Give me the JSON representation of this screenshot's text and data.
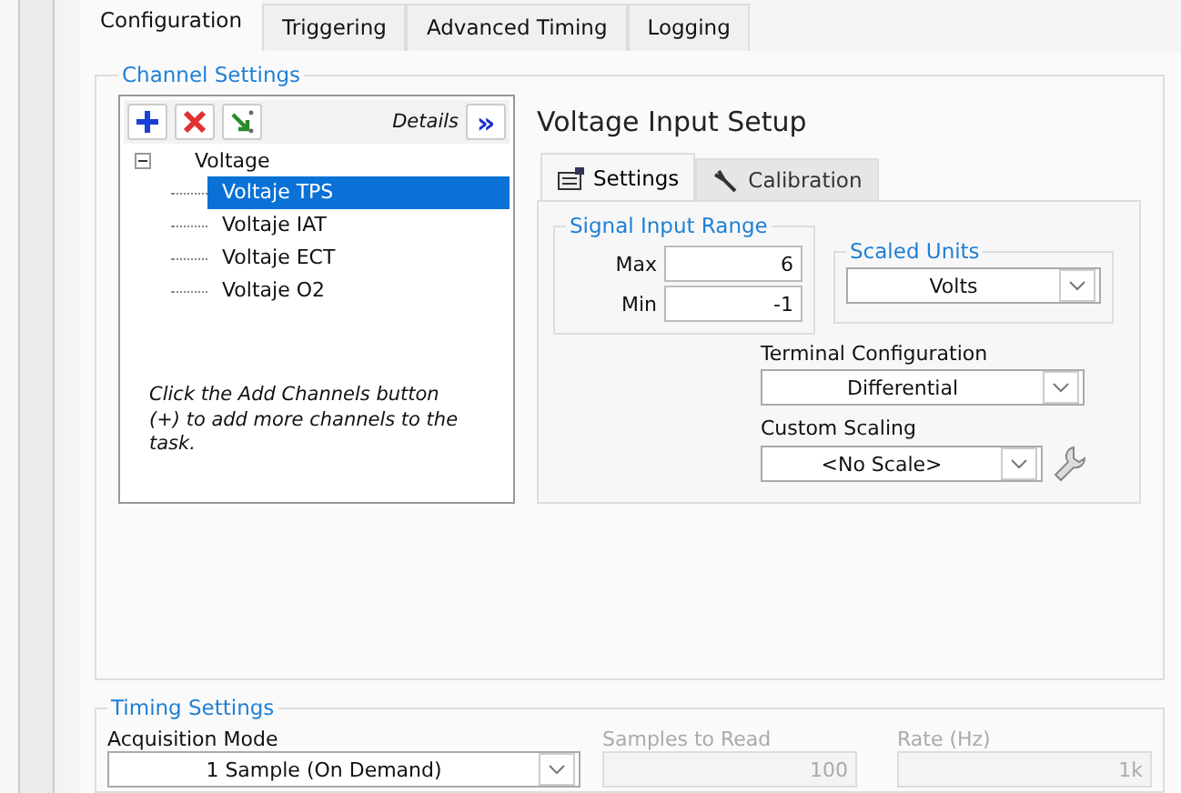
{
  "tabs": [
    {
      "label": "Configuration",
      "selected": true
    },
    {
      "label": "Triggering",
      "selected": false
    },
    {
      "label": "Advanced Timing",
      "selected": false
    },
    {
      "label": "Logging",
      "selected": false
    }
  ],
  "channel_settings": {
    "title": "Channel Settings",
    "details_label": "Details",
    "details_button": "»",
    "tree": [
      {
        "label": "Voltage",
        "expanded": true,
        "selected": false,
        "children": [
          {
            "label": "Voltaje TPS",
            "selected": true
          },
          {
            "label": "Voltaje IAT",
            "selected": false
          },
          {
            "label": "Voltaje ECT",
            "selected": false
          },
          {
            "label": "Voltaje O2",
            "selected": false
          }
        ]
      }
    ],
    "hint": "Click the Add Channels button (+) to add more channels to the task.",
    "setup": {
      "title": "Voltage Input Setup",
      "tabs": [
        {
          "label": "Settings",
          "selected": true
        },
        {
          "label": "Calibration",
          "selected": false
        }
      ],
      "signal_input_range": {
        "title": "Signal Input Range",
        "max_label": "Max",
        "max": "6",
        "min_label": "Min",
        "min": "-1"
      },
      "scaled_units": {
        "title": "Scaled Units",
        "value": "Volts"
      },
      "terminal_configuration": {
        "label": "Terminal Configuration",
        "value": "Differential"
      },
      "custom_scaling": {
        "label": "Custom Scaling",
        "value": "<No Scale>"
      }
    }
  },
  "timing_settings": {
    "title": "Timing Settings",
    "fields": [
      {
        "label": "Acquisition Mode",
        "value": "1 Sample (On Demand)",
        "kind": "dropdown",
        "disabled": false
      },
      {
        "label": "Samples to Read",
        "value": "100",
        "kind": "number",
        "disabled": true
      },
      {
        "label": "Rate (Hz)",
        "value": "1k",
        "kind": "number",
        "disabled": true
      }
    ]
  }
}
